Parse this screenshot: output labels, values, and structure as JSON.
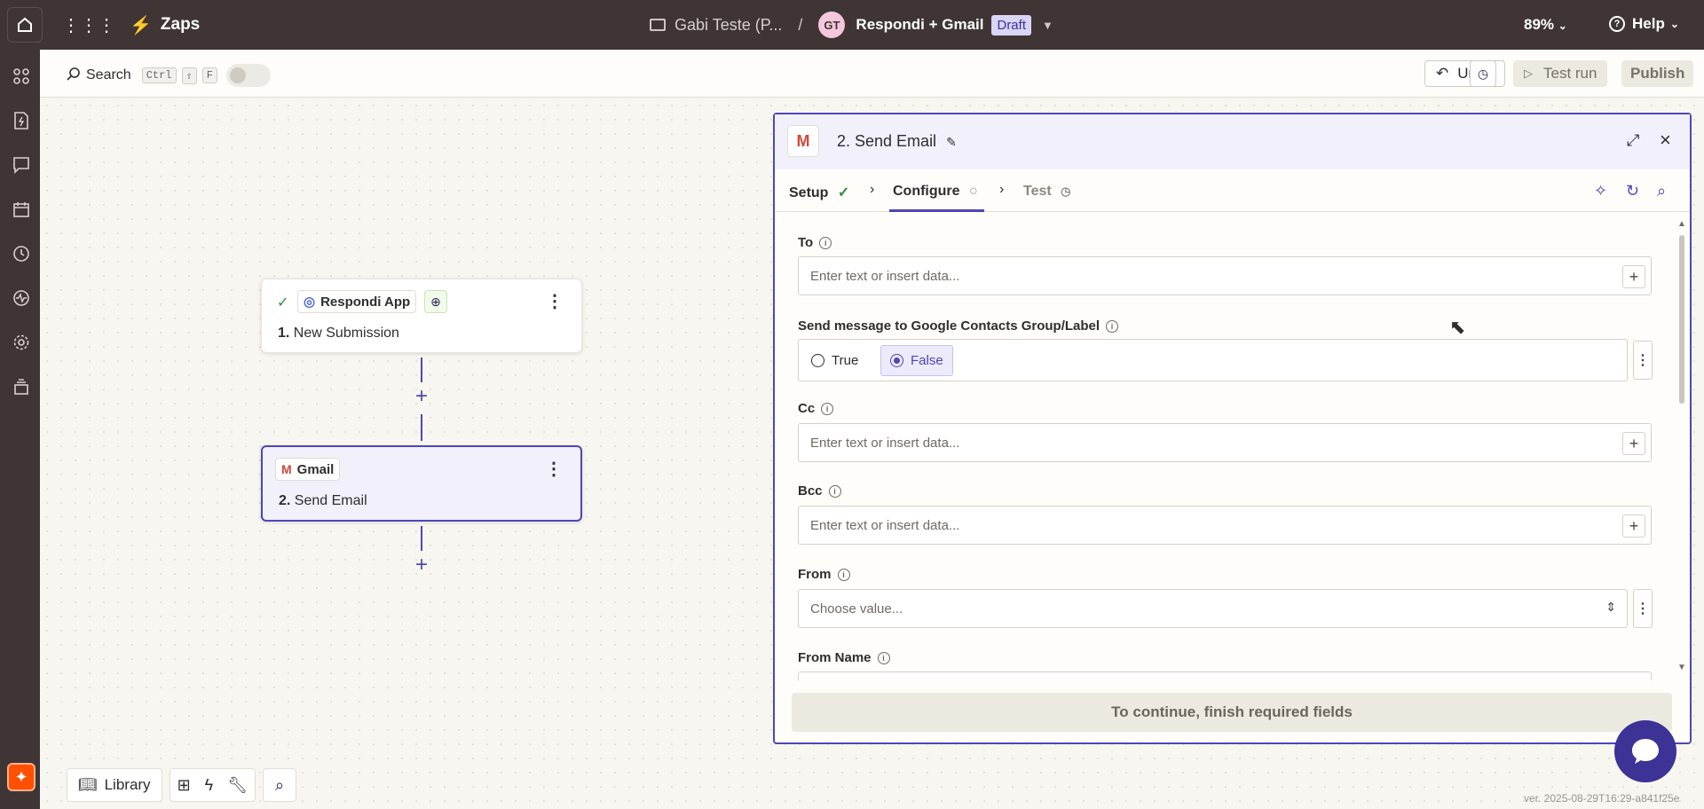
{
  "topbar": {
    "app_name": "Zaps",
    "folder_name": "Gabi Teste (P...",
    "separator": "/",
    "avatar_initials": "GT",
    "zap_name": "Respondi + Gmail",
    "status_badge": "Draft",
    "zoom": "89%",
    "help_label": "Help"
  },
  "toolbar": {
    "search_label": "Search",
    "shortcut_keys": [
      "Ctrl",
      "⇧",
      "F"
    ],
    "undo_label": "Undo",
    "test_run_label": "Test run",
    "publish_label": "Publish"
  },
  "steps": [
    {
      "app": "Respondi App",
      "number": "1.",
      "title": "New Submission"
    },
    {
      "app": "Gmail",
      "number": "2.",
      "title": "Send Email"
    }
  ],
  "panel": {
    "title": "2. Send Email",
    "tabs": [
      {
        "label": "Setup",
        "state": "complete"
      },
      {
        "label": "Configure",
        "state": "active"
      },
      {
        "label": "Test",
        "state": "pending"
      }
    ],
    "fields": {
      "to": {
        "label": "To",
        "placeholder": "Enter text or insert data..."
      },
      "send_to_group": {
        "label": "Send message to Google Contacts Group/Label",
        "options": [
          "True",
          "False"
        ],
        "selected": "False"
      },
      "cc": {
        "label": "Cc",
        "placeholder": "Enter text or insert data..."
      },
      "bcc": {
        "label": "Bcc",
        "placeholder": "Enter text or insert data..."
      },
      "from": {
        "label": "From",
        "placeholder": "Choose value..."
      },
      "from_name": {
        "label": "From Name"
      }
    },
    "footer_label": "To continue, finish required fields"
  },
  "bottom_bar": {
    "library_label": "Library"
  },
  "version": "ver. 2025-08-29T16:29-a841f25e",
  "colors": {
    "topbar_bg": "#403535",
    "accent": "#4f46b8",
    "brand_orange": "#ff4f00"
  }
}
